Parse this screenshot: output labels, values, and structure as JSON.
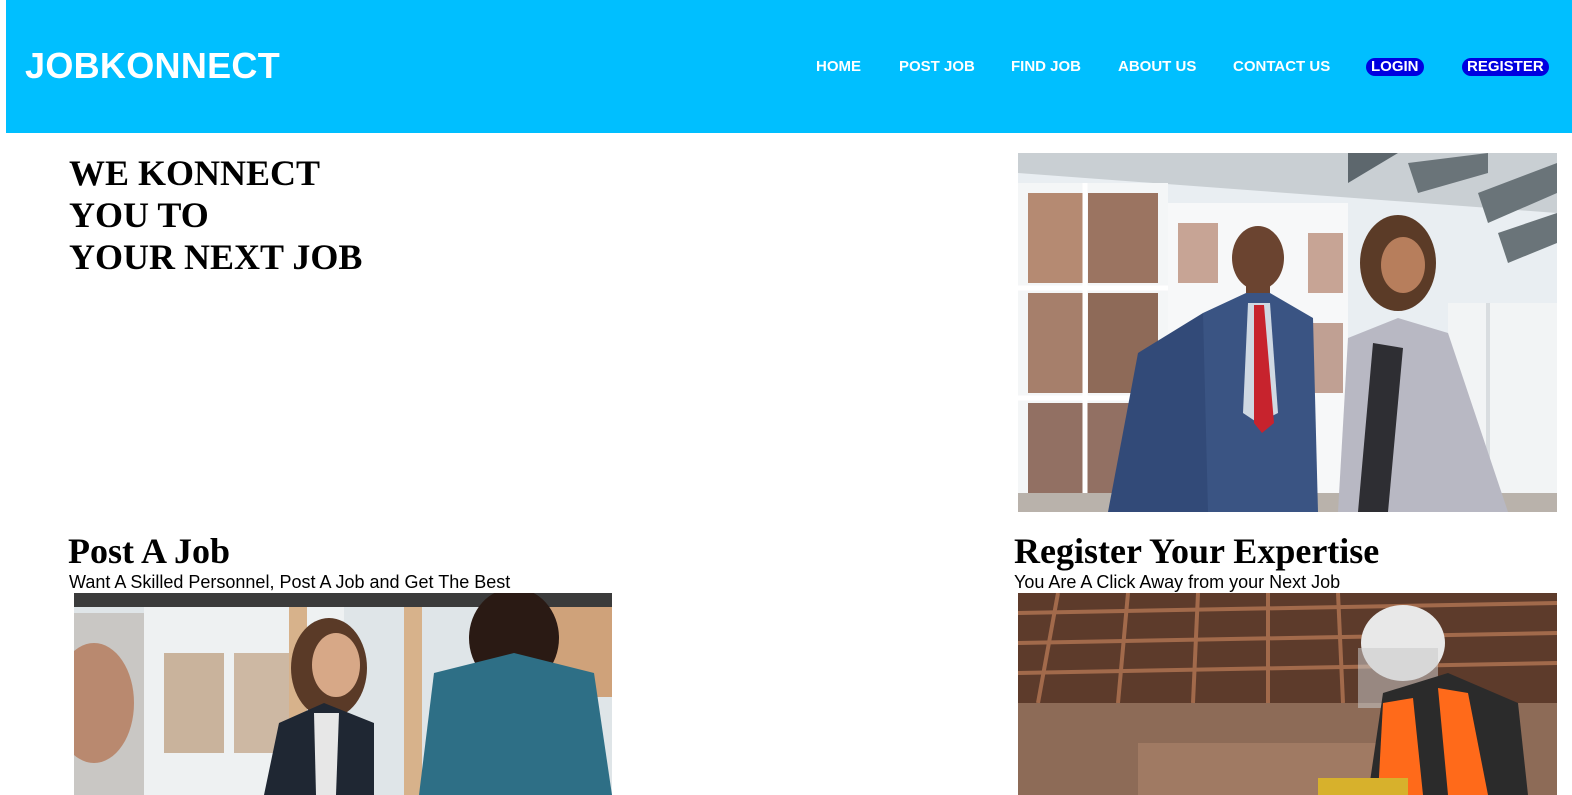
{
  "brand": {
    "logo_text": "JOBKONNECT",
    "header_color": "#00bfff",
    "pill_color": "#0000e0"
  },
  "nav": {
    "home": "HOME",
    "post_job": "POST JOB",
    "find_job": "FIND JOB",
    "about_us": "ABOUT US",
    "contact_us": "CONTACT US",
    "login": "LOGIN",
    "register": "REGISTER"
  },
  "hero": {
    "line1": "WE KONNECT",
    "line2": "YOU TO",
    "line3": "YOUR NEXT JOB",
    "image_icon": "business-people-photo"
  },
  "post_job": {
    "title": "Post A Job",
    "subtitle": "Want A Skilled Personnel, Post A Job and Get The Best",
    "image_icon": "handshake-interview-photo"
  },
  "register_expertise": {
    "title": "Register Your Expertise",
    "subtitle": "You Are A Click Away from your Next Job",
    "image_icon": "construction-worker-photo"
  }
}
